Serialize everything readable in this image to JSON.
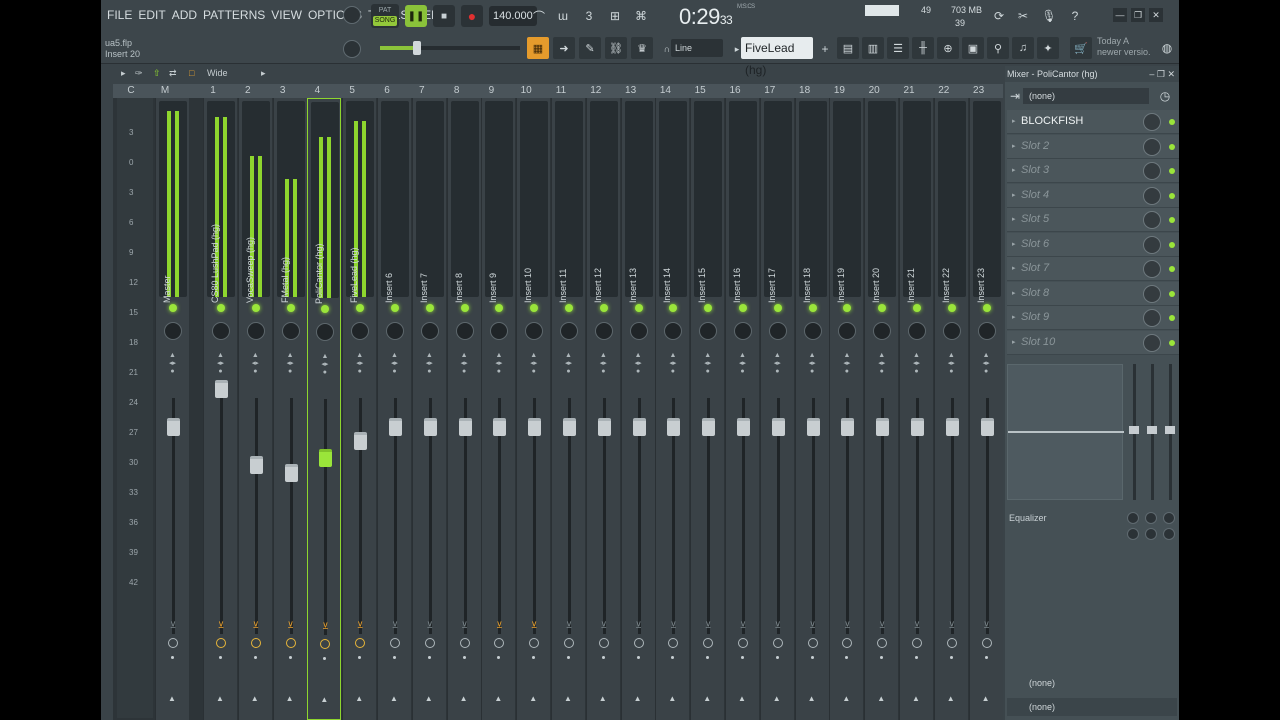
{
  "menu": [
    "FILE",
    "EDIT",
    "ADD",
    "PATTERNS",
    "VIEW",
    "OPTIONS",
    "TOOLS",
    "HELP"
  ],
  "file": {
    "name": "ua5.flp",
    "target": "Insert 20"
  },
  "transport": {
    "pat": "PAT",
    "song": "SONG",
    "tempo": "140.000"
  },
  "time": {
    "main": "0:29",
    "sub": "33",
    "unit": "M:S:CS"
  },
  "cpu": {
    "value": "49",
    "memory": "703 MB",
    "polyphony": "39"
  },
  "tip": {
    "line1": "Today  A",
    "line2": "newer versio."
  },
  "toolbar": {
    "snap": "Line",
    "pattern": "FiveLead (hg)"
  },
  "mixer_toolbar": {
    "view": "Wide"
  },
  "numbers": [
    "C",
    "M",
    "1",
    "2",
    "3",
    "4",
    "5",
    "6",
    "7",
    "8",
    "9",
    "10",
    "11",
    "12",
    "13",
    "14",
    "15",
    "16",
    "17",
    "18",
    "19",
    "20",
    "21",
    "22",
    "23"
  ],
  "db_scale": [
    "3",
    "0",
    "3",
    "6",
    "9",
    "12",
    "15",
    "18",
    "21",
    "24",
    "27",
    "30",
    "33",
    "36",
    "39",
    "42"
  ],
  "tracks": [
    {
      "name": "Master",
      "level": 0.95
    },
    {
      "name": "CS80 LushPad (hg)",
      "level": 0.92
    },
    {
      "name": "VocaSweep (hg)",
      "level": 0.72
    },
    {
      "name": "FMetal (hg)",
      "level": 0.6
    },
    {
      "name": "PoliCantor (hg)",
      "level": 0.82
    },
    {
      "name": "FiveLead (hg)",
      "level": 0.9
    },
    {
      "name": "Insert 6",
      "level": 0
    },
    {
      "name": "Insert 7",
      "level": 0
    },
    {
      "name": "Insert 8",
      "level": 0
    },
    {
      "name": "Insert 9",
      "level": 0
    },
    {
      "name": "Insert 10",
      "level": 0
    },
    {
      "name": "Insert 11",
      "level": 0
    },
    {
      "name": "Insert 12",
      "level": 0
    },
    {
      "name": "Insert 13",
      "level": 0
    },
    {
      "name": "Insert 14",
      "level": 0
    },
    {
      "name": "Insert 15",
      "level": 0
    },
    {
      "name": "Insert 16",
      "level": 0
    },
    {
      "name": "Insert 17",
      "level": 0
    },
    {
      "name": "Insert 18",
      "level": 0
    },
    {
      "name": "Insert 19",
      "level": 0
    },
    {
      "name": "Insert 20",
      "level": 0
    },
    {
      "name": "Insert 21",
      "level": 0
    },
    {
      "name": "Insert 22",
      "level": 0
    },
    {
      "name": "Insert 23",
      "level": 0
    }
  ],
  "panel": {
    "title": "Mixer - PoliCantor (hg)",
    "input": "(none)",
    "slots": [
      "BLOCKFISH",
      "Slot 2",
      "Slot 3",
      "Slot 4",
      "Slot 5",
      "Slot 6",
      "Slot 7",
      "Slot 8",
      "Slot 9",
      "Slot 10"
    ],
    "eq_label": "Equalizer",
    "output1": "(none)",
    "output2": "(none)"
  },
  "colors": {
    "accent": "#9ae53a",
    "orange": "#e7a02f"
  }
}
